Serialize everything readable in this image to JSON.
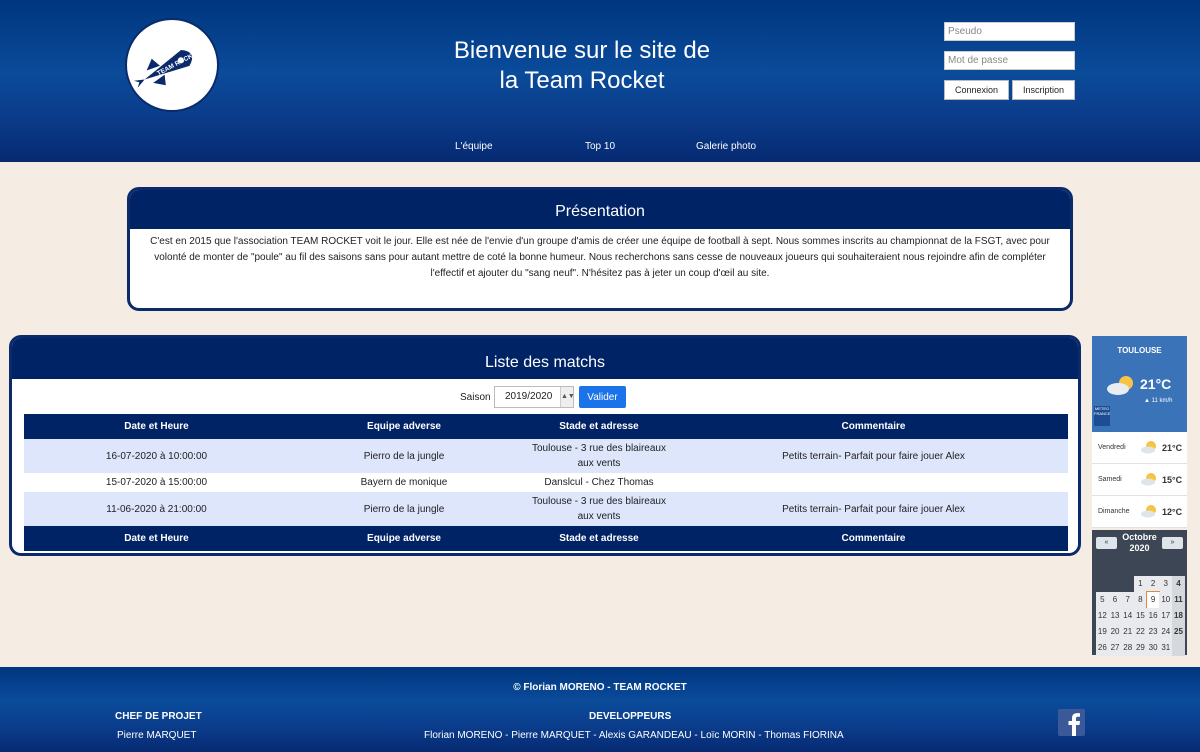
{
  "header": {
    "title_line1": "Bienvenue sur le site de",
    "title_line2": "la Team Rocket",
    "logo_text": "TEAM ROCKET",
    "pseudo_placeholder": "Pseudo",
    "password_placeholder": "Mot de passe",
    "login_label": "Connexion",
    "signup_label": "Inscription"
  },
  "nav": {
    "items": [
      "L'équipe",
      "Top 10",
      "Galerie photo"
    ]
  },
  "presentation": {
    "title": "Présentation",
    "text": "C'est en 2015 que l'association TEAM ROCKET voit le jour. Elle est née de l'envie d'un groupe d'amis de créer une équipe de football à sept. Nous sommes inscrits au championnat de la FSGT, avec pour volonté de monter de \"poule\" au fil des saisons sans pour autant mettre de coté la bonne humeur. Nous recherchons sans cesse de nouveaux joueurs qui souhaiteraient nous rejoindre afin de compléter l'effectif et ajouter du \"sang neuf\". N'hésitez pas à jeter un coup d'œil au site."
  },
  "matches": {
    "title": "Liste des matchs",
    "season_label": "Saison",
    "season_value": "2019/2020",
    "validate_label": "Valider",
    "columns": [
      "Date et Heure",
      "Equipe adverse",
      "Stade et adresse",
      "Commentaire"
    ],
    "rows": [
      {
        "date": "16-07-2020 à 10:00:00",
        "team": "Pierro de la jungle",
        "stadium": "Toulouse - 3 rue des blaireaux aux vents",
        "comment": "Petits terrain- Parfait pour faire jouer Alex"
      },
      {
        "date": "15-07-2020 à 15:00:00",
        "team": "Bayern de monique",
        "stadium": "Danslcul - Chez Thomas",
        "comment": ""
      },
      {
        "date": "11-06-2020 à 21:00:00",
        "team": "Pierro de la jungle",
        "stadium": "Toulouse - 3 rue des blaireaux aux vents",
        "comment": "Petits terrain- Parfait pour faire jouer Alex"
      }
    ]
  },
  "weather": {
    "city": "TOULOUSE",
    "temp": "21°C",
    "wind": "11 km/h",
    "badge": "METEO FRANCE",
    "days": [
      {
        "name": "Vendredi",
        "temp": "21°C"
      },
      {
        "name": "Samedi",
        "temp": "15°C"
      },
      {
        "name": "Dimanche",
        "temp": "12°C"
      }
    ]
  },
  "calendar": {
    "month": "Octobre",
    "year": "2020",
    "prev": "«",
    "next": "»",
    "days": [
      "",
      "",
      "",
      "1",
      "2",
      "3",
      "4",
      "5",
      "6",
      "7",
      "8",
      "9",
      "10",
      "11",
      "12",
      "13",
      "14",
      "15",
      "16",
      "17",
      "18",
      "19",
      "20",
      "21",
      "22",
      "23",
      "24",
      "25",
      "26",
      "27",
      "28",
      "29",
      "30",
      "31",
      ""
    ],
    "today": "9"
  },
  "footer": {
    "copyright": "© Florian MORENO - TEAM ROCKET",
    "chef_title": "CHEF DE PROJET",
    "chef_name": "Pierre MARQUET",
    "dev_title": "DEVELOPPEURS",
    "dev_names": "Florian MORENO - Pierre MARQUET - Alexis GARANDEAU - Loïc MORIN - Thomas FIORINA"
  }
}
